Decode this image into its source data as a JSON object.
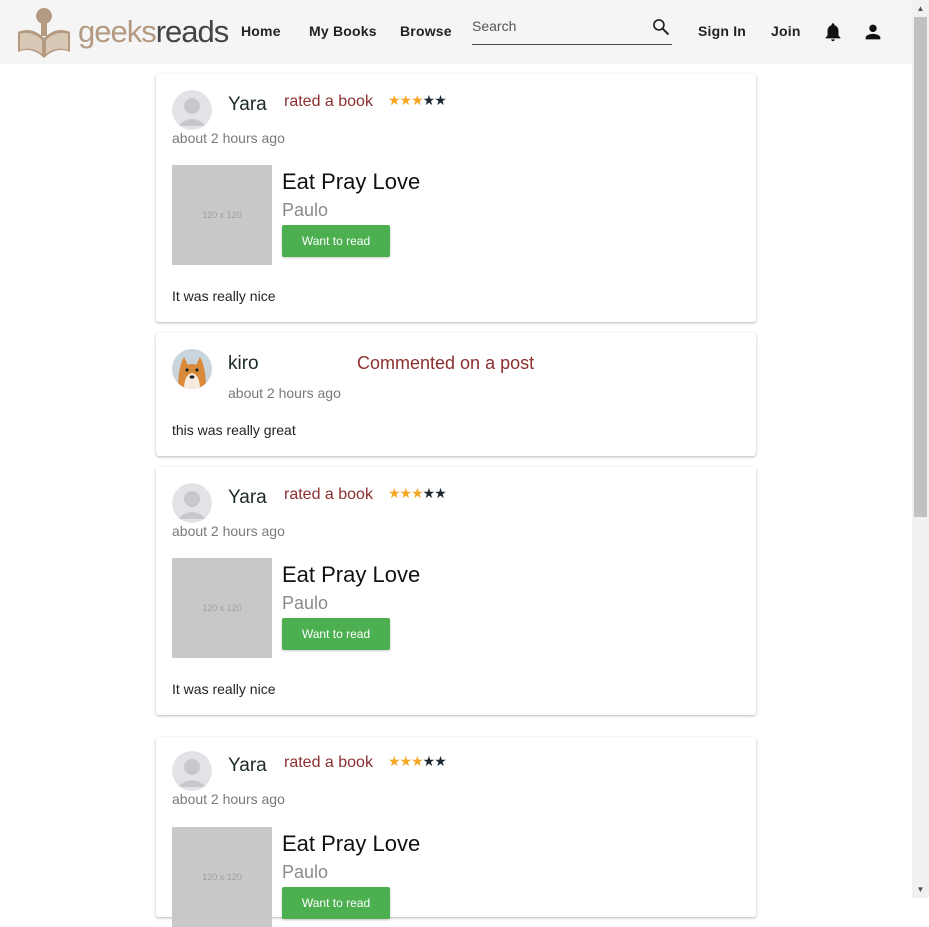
{
  "brand": {
    "part1": "geeks",
    "part2": "reads"
  },
  "nav": {
    "home": "Home",
    "my_books": "My Books",
    "browse": "Browse",
    "search_placeholder": "Search",
    "sign_in": "Sign In",
    "join": "Join",
    "icons": [
      "search-icon",
      "bell-icon",
      "user-icon"
    ]
  },
  "colors": {
    "accent_green": "#4caf50",
    "action_red": "#8b2f2f",
    "star_gold": "#f5a623",
    "navbar_bg": "#f5f5f5"
  },
  "feed": [
    {
      "user": "Yara",
      "action": "rated a book",
      "rating": 3,
      "rating_max": 5,
      "time": "about 2 hours ago",
      "book": {
        "cover_label": "120 x 120",
        "title": "Eat Pray Love",
        "author": "Paulo",
        "button": "Want to read"
      },
      "text": "It was really nice"
    },
    {
      "user": "kiro",
      "action": "Commented on a post",
      "time": "about 2 hours ago",
      "text": "this was really great"
    },
    {
      "user": "Yara",
      "action": "rated a book",
      "rating": 3,
      "rating_max": 5,
      "time": "about 2 hours ago",
      "book": {
        "cover_label": "120 x 120",
        "title": "Eat Pray Love",
        "author": "Paulo",
        "button": "Want to read"
      },
      "text": "It was really nice"
    },
    {
      "user": "Yara",
      "action": "rated a book",
      "rating": 3,
      "rating_max": 5,
      "time": "about 2 hours ago",
      "book": {
        "cover_label": "120 x 120",
        "title": "Eat Pray Love",
        "author": "Paulo",
        "button": "Want to read"
      }
    }
  ]
}
